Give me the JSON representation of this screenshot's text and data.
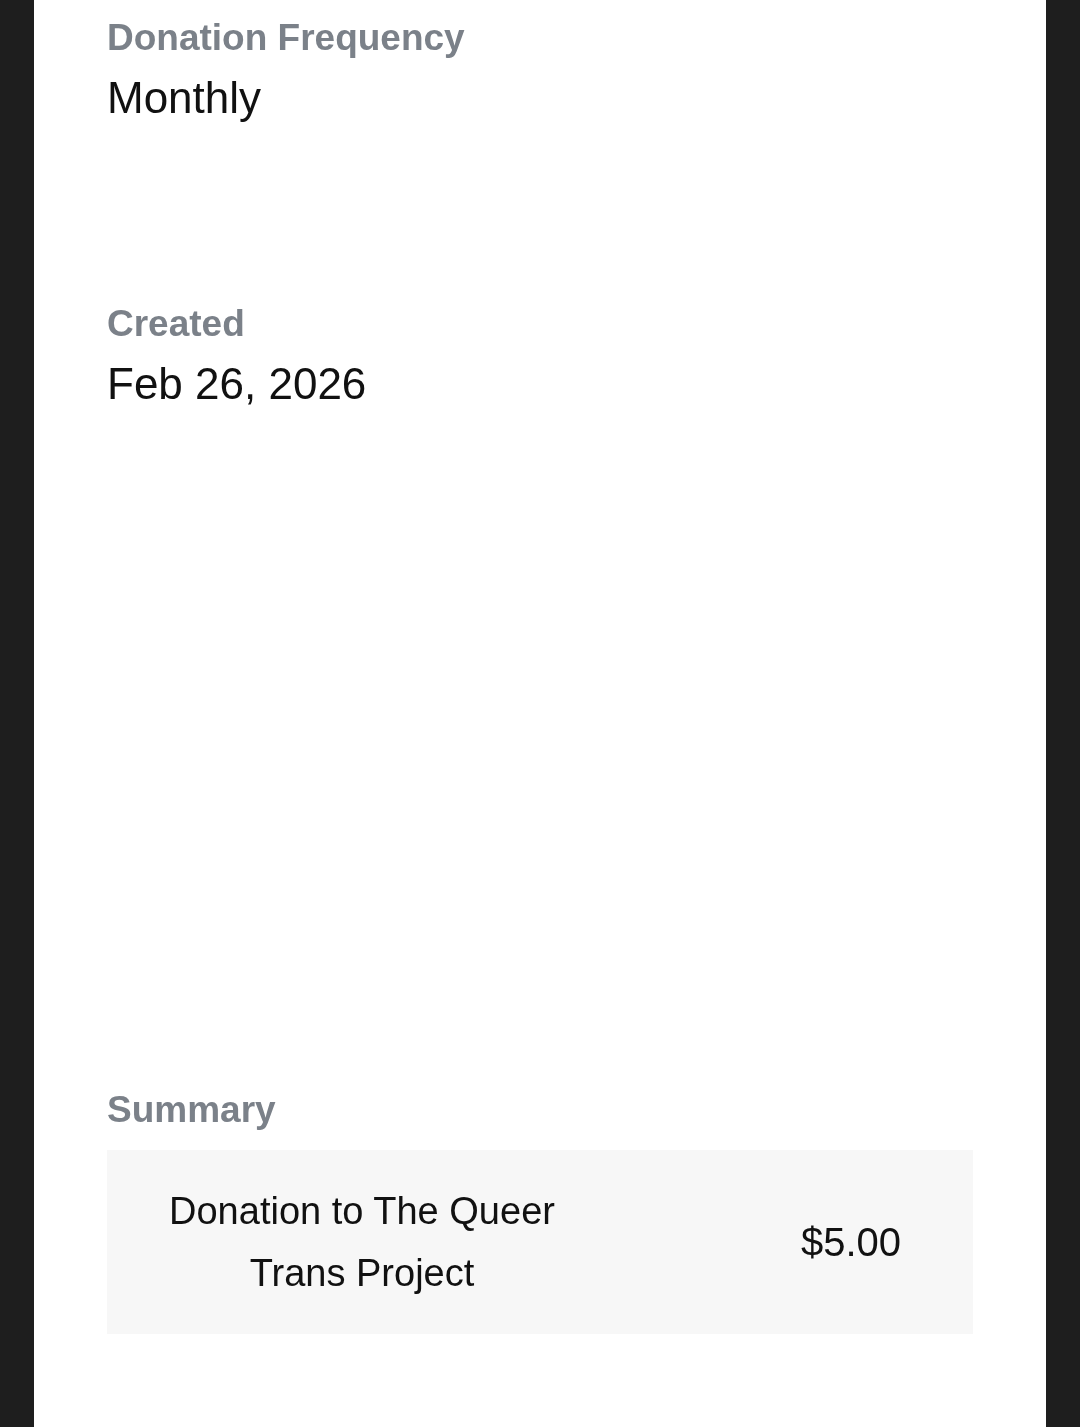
{
  "fields": [
    {
      "label": "Donation Frequency",
      "value": "Monthly"
    },
    {
      "label": "Created",
      "value": "Feb 26, 2026"
    }
  ],
  "summary": {
    "heading": "Summary",
    "items": [
      {
        "description": "Donation to The Queer Trans Project",
        "amount": "$5.00"
      }
    ]
  }
}
